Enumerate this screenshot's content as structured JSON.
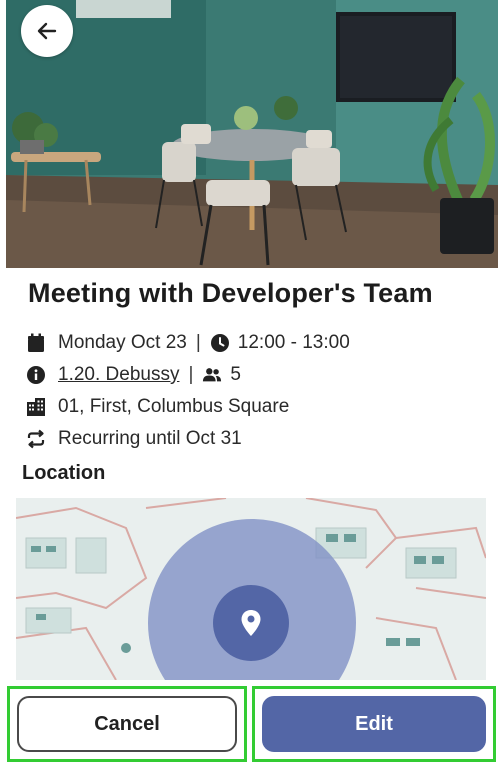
{
  "event": {
    "title": "Meeting with Developer's Team",
    "date": "Monday Oct 23",
    "time": "12:00 - 13:00",
    "room": "1.20. Debussy",
    "attendees": "5",
    "building": "01, First, Columbus Square",
    "recurrence": "Recurring until Oct 31"
  },
  "location": {
    "section_title": "Location"
  },
  "actions": {
    "cancel_label": "Cancel",
    "edit_label": "Edit"
  },
  "colors": {
    "primary": "#5366a6",
    "highlight_outline": "#33cc33",
    "pin_circle": "#8191c6"
  },
  "icons": [
    "arrow-left-icon",
    "calendar-icon",
    "clock-icon",
    "info-icon",
    "people-icon",
    "building-icon",
    "repeat-icon",
    "location-pin-icon"
  ]
}
